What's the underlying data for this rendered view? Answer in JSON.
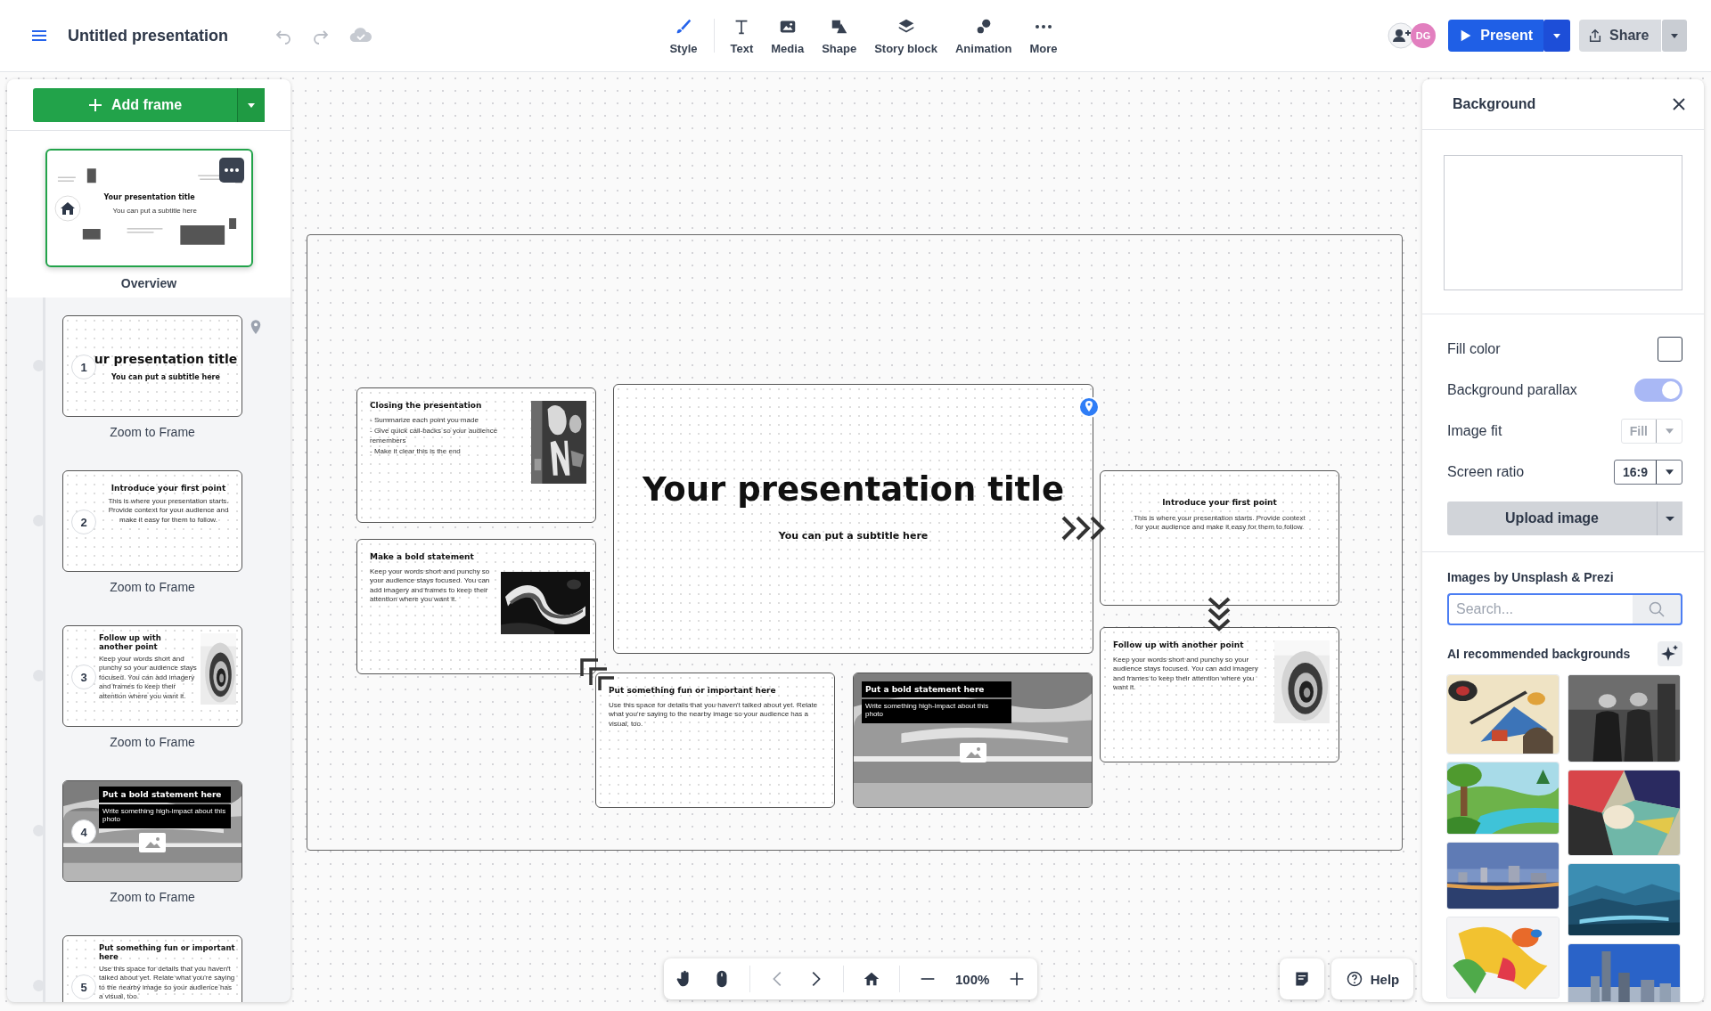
{
  "top_bar": {
    "title": "Untitled presentation",
    "tools": [
      {
        "label": "Style",
        "kind": "style",
        "selected": true
      },
      {
        "label": "Text",
        "kind": "text",
        "selected": false
      },
      {
        "label": "Media",
        "kind": "media",
        "selected": false
      },
      {
        "label": "Shape",
        "kind": "shape",
        "selected": false
      },
      {
        "label": "Story block",
        "kind": "story",
        "selected": false
      },
      {
        "label": "Animation",
        "kind": "animation",
        "selected": false
      },
      {
        "label": "More",
        "kind": "more",
        "selected": false
      }
    ],
    "avatar": {
      "initials": "DG",
      "color": "#e27fbf"
    },
    "present_button": "Present",
    "share_button": "Share"
  },
  "sidebar": {
    "add_frame_button": "Add frame",
    "overview": {
      "label": "Overview",
      "selected": true,
      "title": "Your presentation title",
      "subtitle": "You can put a subtitle here"
    },
    "frames": [
      {
        "number": "1",
        "label": "Zoom to Frame",
        "kind": "title",
        "title": "ur presentation title",
        "body": "You can put a subtitle here",
        "pinned": true
      },
      {
        "number": "2",
        "label": "Zoom to Frame",
        "kind": "centered",
        "title": "Introduce your first point",
        "body": "This is where your presentation starts. Provide context for your audience and make it easy for them to follow.",
        "pinned": false
      },
      {
        "number": "3",
        "label": "Zoom to Frame",
        "kind": "text-image",
        "title": "Follow up with another point",
        "body": "Keep your words short and punchy so your audience stays focused. You can add imagery and frames to keep their attention where you want it.",
        "pinned": false
      },
      {
        "number": "4",
        "label": "Zoom to Frame",
        "title": "Put a bold statement here",
        "body": "Write something high-impact about this photo",
        "pinned": false
      },
      {
        "number": "5",
        "kind": "text",
        "title": "Put something fun or important here",
        "body": "Use this space for details that you haven't talked about yet. Relate what you're saying to the nearby image so your audience has a visual, too.",
        "pinned": false
      }
    ]
  },
  "canvas": {
    "frames": [
      {
        "kind": "text-image",
        "title": "Closing the presentation",
        "bullets": [
          "- Summarize each point you made",
          "- Give quick call-backs so your audience remembers",
          "- Make it clear this is the end"
        ]
      },
      {
        "kind": "text-image",
        "title": "Make a bold statement",
        "body": "Keep your words short and punchy so your audience stays focused. You can add imagery and frames to keep their attention where you want it."
      },
      {
        "kind": "title",
        "title": "Your presentation title",
        "body": "You can put a subtitle here"
      },
      {
        "kind": "centered",
        "title": "Introduce your first point",
        "body": "This is where your presentation starts. Provide context for your audience and make it easy for them to follow."
      },
      {
        "kind": "text-image",
        "title": "Follow up with another point",
        "body": "Keep your words short and punchy so your audience stays focused. You can add imagery and frames to keep their attention where you want it."
      },
      {
        "kind": "text",
        "title": "Put something fun or important here",
        "body": "Use this space for details that you haven't talked about yet. Relate what you're saying to the nearby image so your audience has a visual, too."
      },
      {
        "title": "Put a bold statement here",
        "body": "Write something high-impact about this photo"
      }
    ],
    "zoom": "100%"
  },
  "help_button": "Help",
  "background_panel": {
    "title": "Background",
    "fill_color": {
      "label": "Fill color"
    },
    "parallax": {
      "label": "Background parallax",
      "on": true
    },
    "image_fit": {
      "label": "Image fit",
      "value": "Fill",
      "disabled": true
    },
    "screen_ratio": {
      "label": "Screen ratio",
      "value": "16:9",
      "disabled": false
    },
    "upload_button": "Upload image",
    "images_heading": "Images by Unsplash & Prezi",
    "search": {
      "placeholder": "Search..."
    },
    "ai_heading": "AI recommended backgrounds"
  }
}
